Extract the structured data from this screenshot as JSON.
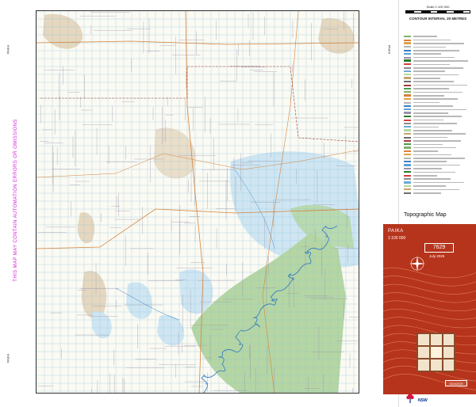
{
  "sheet": {
    "name": "PAIKA",
    "number": "7629",
    "scale": "1:100 000",
    "date": "July 2025",
    "datum": "GDA2020",
    "type": "Topographic Map",
    "warning": "THIS MAP MAY CONTAIN AUTOMATION ERRORS OR OMISSIONS",
    "contour_interval": "CONTOUR INTERVAL 20 METRES",
    "scale_title": "Scale 1:100 000",
    "agency": "NSW"
  },
  "map": {
    "colors": {
      "background": "#fbfaf3",
      "lake": "#cfe6f2",
      "forest": "#b5d6a2",
      "sand": "#e6d7be",
      "grid": "#8fc3dc",
      "road": "#d7833b",
      "fence": "#9a8fa8",
      "river": "#3b7fbf",
      "boundary": "#a23b3b"
    }
  },
  "legend": {
    "colors": [
      "#7fb26b",
      "#d7833b",
      "#e0a24a",
      "#b4b4b4",
      "#3b7fbf",
      "#5f9fd4",
      "#9a8fa8",
      "#2a7a2a",
      "#d04040",
      "#8a8a8a",
      "#6ba8d8",
      "#b5d6a2",
      "#c9a56b",
      "#6e6e6e",
      "#a23b3b",
      "#4d9b4d"
    ]
  }
}
